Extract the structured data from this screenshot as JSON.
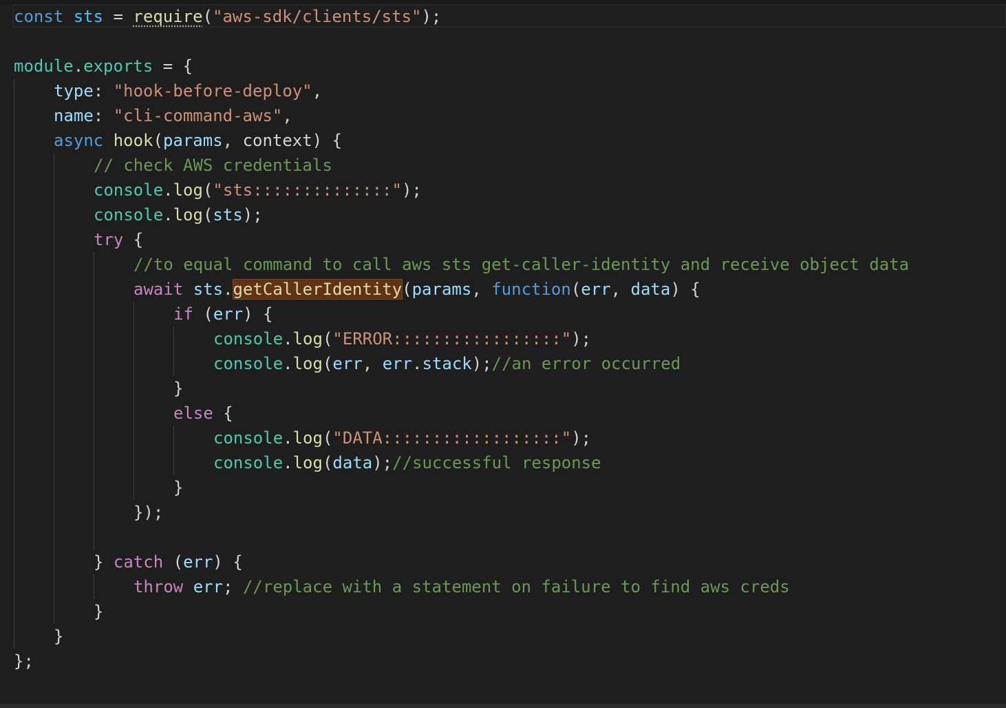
{
  "code": {
    "line1": {
      "kw_const": "const",
      "var_sts": "sts",
      "op_assign": " = ",
      "fn_require": "require",
      "paren_open": "(",
      "str_module": "\"aws-sdk/clients/sts\"",
      "end": ");"
    },
    "line3": {
      "obj_module": "module",
      "dot": ".",
      "prop_exports": "exports",
      "rest": " = {"
    },
    "line4": {
      "prop_type": "type",
      "colon": ": ",
      "str_type": "\"hook-before-deploy\"",
      "comma": ","
    },
    "line5": {
      "prop_name": "name",
      "colon": ": ",
      "str_name": "\"cli-command-aws\"",
      "comma": ","
    },
    "line6": {
      "kw_async": "async",
      "fn_hook": "hook",
      "paren_open": "(",
      "param_params": "params",
      "comma": ", ",
      "param_context": "context",
      "rest": ") {"
    },
    "line7": {
      "comment": "// check AWS credentials"
    },
    "line8": {
      "obj": "console",
      "dot": ".",
      "fn": "log",
      "paren_open": "(",
      "str": "\"sts::::::::::::::\"",
      "end": ");"
    },
    "line9": {
      "obj": "console",
      "dot": ".",
      "fn": "log",
      "paren_open": "(",
      "arg": "sts",
      "end": ");"
    },
    "line10": {
      "kw_try": "try",
      "rest": " {"
    },
    "line11": {
      "comment": "//to equal command to call aws sts get-caller-identity and receive object data"
    },
    "line12": {
      "kw_await": "await",
      "var_sts": "sts",
      "dot": ".",
      "fn_selected": "getCallerIdentity",
      "paren_open": "(",
      "arg_params": "params",
      "comma": ", ",
      "kw_function": "function",
      "paren_open2": "(",
      "arg_err": "err",
      "comma2": ", ",
      "arg_data": "data",
      "rest": ") {"
    },
    "line13": {
      "kw_if": "if",
      "paren_open": " (",
      "arg": "err",
      "rest": ") {"
    },
    "line14": {
      "obj": "console",
      "dot": ".",
      "fn": "log",
      "paren_open": "(",
      "str": "\"ERROR:::::::::::::::::\"",
      "end": ");"
    },
    "line15": {
      "obj": "console",
      "dot": ".",
      "fn": "log",
      "paren_open": "(",
      "arg_err": "err",
      "comma": ", ",
      "arg_err2": "err",
      "dot2": ".",
      "prop_stack": "stack",
      "end": ");",
      "comment": "//an error occurred"
    },
    "line16": {
      "brace": "}"
    },
    "line17": {
      "kw_else": "else",
      "rest": " {"
    },
    "line18": {
      "obj": "console",
      "dot": ".",
      "fn": "log",
      "paren_open": "(",
      "str": "\"DATA::::::::::::::::::\"",
      "end": ");"
    },
    "line19": {
      "obj": "console",
      "dot": ".",
      "fn": "log",
      "paren_open": "(",
      "arg": "data",
      "end": ");",
      "comment": "//successful response"
    },
    "line20": {
      "brace": "}"
    },
    "line21": {
      "close": "});"
    },
    "line23": {
      "brace": "} ",
      "kw_catch": "catch",
      "paren_open": " (",
      "arg": "err",
      "rest": ") {"
    },
    "line24": {
      "kw_throw": "throw",
      "space": " ",
      "arg": "err",
      "semi": "; ",
      "comment": "//replace with a statement on failure to find aws creds"
    },
    "line25": {
      "brace": "}"
    },
    "line26": {
      "brace": "}"
    },
    "line27": {
      "close": "};"
    }
  }
}
